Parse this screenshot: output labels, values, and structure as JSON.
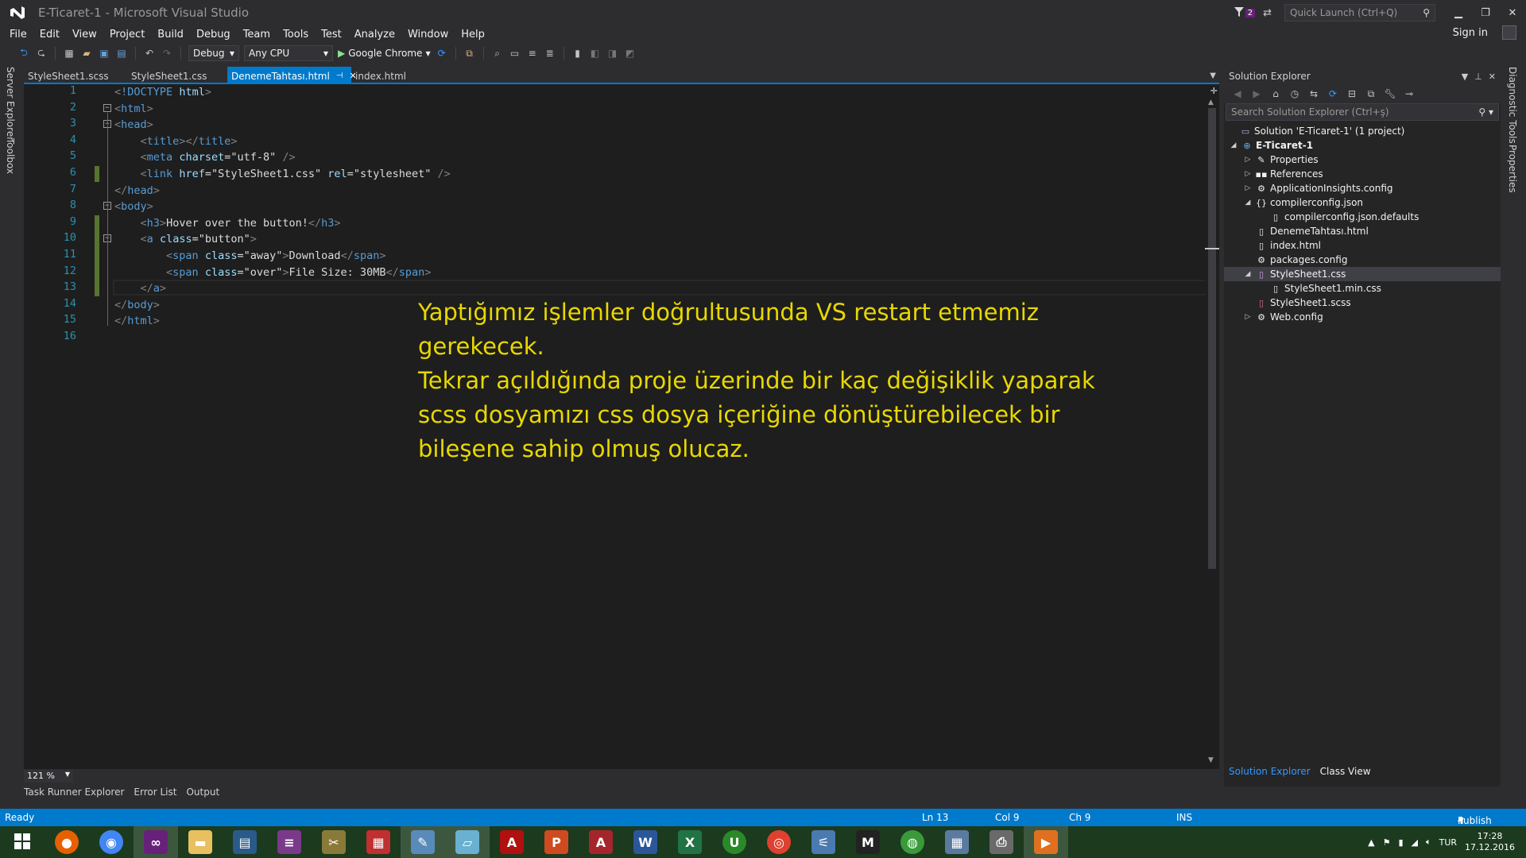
{
  "window": {
    "title": "E-Ticaret-1 - Microsoft Visual Studio",
    "notification_count": "2",
    "quick_launch_placeholder": "Quick Launch (Ctrl+Q)"
  },
  "menu": {
    "items": [
      "File",
      "Edit",
      "View",
      "Project",
      "Build",
      "Debug",
      "Team",
      "Tools",
      "Test",
      "Analyze",
      "Window",
      "Help"
    ],
    "sign_in": "Sign in"
  },
  "toolbar": {
    "configuration": "Debug",
    "platform": "Any CPU",
    "run_target": "Google Chrome"
  },
  "left_strip": [
    "Server Explorer",
    "Toolbox"
  ],
  "right_strip": [
    "Diagnostic Tools",
    "Properties"
  ],
  "tabs": [
    {
      "label": "StyleSheet1.scss",
      "active": false
    },
    {
      "label": "StyleSheet1.css",
      "active": false
    },
    {
      "label": "DenemeTahtası.html",
      "active": true
    },
    {
      "label": "index.html",
      "active": false
    }
  ],
  "editor": {
    "line_numbers": [
      "1",
      "2",
      "3",
      "4",
      "5",
      "6",
      "7",
      "8",
      "9",
      "10",
      "11",
      "12",
      "13",
      "14",
      "15",
      "16"
    ],
    "lines": [
      "<!DOCTYPE html>",
      "<html>",
      "<head>",
      "    <title></title>",
      "    <meta charset=\"utf-8\" />",
      "    <link href=\"StyleSheet1.css\" rel=\"stylesheet\" />",
      "</head>",
      "<body>",
      "    <h3>Hover over the button!</h3>",
      "    <a class=\"button\">",
      "        <span class=\"away\">Download</span>",
      "        <span class=\"over\">File Size: 30MB</span>",
      "    </a>",
      "</body>",
      "</html>",
      ""
    ],
    "zoom": "121 %",
    "overlay_lines": [
      "Yaptığımız işlemler doğrultusunda VS restart etmemiz gerekecek.",
      "Tekrar açıldığında proje üzerinde bir kaç değişiklik yaparak scss dosyamızı css dosya içeriğine dönüştürebilecek bir bileşene sahip olmuş olucaz."
    ]
  },
  "bottom_tabs": [
    "Task Runner Explorer",
    "Error List",
    "Output"
  ],
  "solution_explorer": {
    "title": "Solution Explorer",
    "search_placeholder": "Search Solution Explorer (Ctrl+ş)",
    "tree": [
      {
        "label": "Solution 'E-Ticaret-1' (1 project)",
        "depth": 0,
        "twisty": "",
        "icon": "solution-icon"
      },
      {
        "label": "E-Ticaret-1",
        "depth": 1,
        "twisty": "◢",
        "icon": "web-project-icon",
        "bold": true
      },
      {
        "label": "Properties",
        "depth": 2,
        "twisty": "▷",
        "icon": "wrench-icon"
      },
      {
        "label": "References",
        "depth": 2,
        "twisty": "▷",
        "icon": "references-icon"
      },
      {
        "label": "ApplicationInsights.config",
        "depth": 2,
        "twisty": "▷",
        "icon": "config-file-icon"
      },
      {
        "label": "compilerconfig.json",
        "depth": 2,
        "twisty": "◢",
        "icon": "json-file-icon"
      },
      {
        "label": "compilerconfig.json.defaults",
        "depth": 3,
        "twisty": "",
        "icon": "file-icon"
      },
      {
        "label": "DenemeTahtası.html",
        "depth": 2,
        "twisty": "",
        "icon": "html-file-icon"
      },
      {
        "label": "index.html",
        "depth": 2,
        "twisty": "",
        "icon": "html-file-icon"
      },
      {
        "label": "packages.config",
        "depth": 2,
        "twisty": "",
        "icon": "config-file-icon"
      },
      {
        "label": "StyleSheet1.css",
        "depth": 2,
        "twisty": "◢",
        "icon": "css-file-icon",
        "selected": true
      },
      {
        "label": "StyleSheet1.min.css",
        "depth": 3,
        "twisty": "",
        "icon": "file-icon"
      },
      {
        "label": "StyleSheet1.scss",
        "depth": 2,
        "twisty": "",
        "icon": "scss-file-icon"
      },
      {
        "label": "Web.config",
        "depth": 2,
        "twisty": "▷",
        "icon": "config-file-icon"
      }
    ],
    "bottom_tabs": [
      "Solution Explorer",
      "Class View"
    ]
  },
  "status": {
    "state": "Ready",
    "line": "Ln 13",
    "col": "Col 9",
    "ch": "Ch 9",
    "mode": "INS",
    "publish": "Publish"
  },
  "taskbar": {
    "language": "TUR",
    "time": "17:28",
    "date": "17.12.2016"
  },
  "colors": {
    "accent": "#007acc",
    "overlay_text": "#e8d800",
    "editor_bg": "#1e1e1e"
  }
}
